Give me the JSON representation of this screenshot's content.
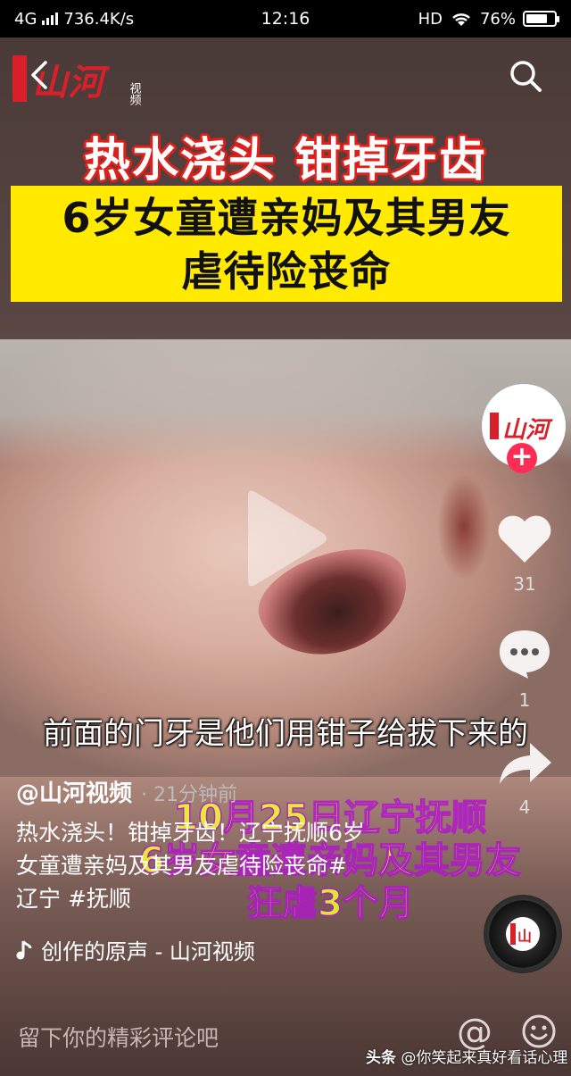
{
  "status_bar": {
    "network": "4G",
    "speed": "736.4K/s",
    "time": "12:16",
    "hd": "HD",
    "battery": "76%",
    "battery_level": 0.76
  },
  "header": {
    "logo_text": "山河",
    "logo_sub": "视频"
  },
  "video": {
    "headline": "热水浇头 钳掉牙齿",
    "subheadline_line1": "6岁女童遭亲妈及其男友",
    "subheadline_line2": "虐待险丧命",
    "caption": "前面的门牙是他们用钳子给拔下来的",
    "overlay_line1": "10月25日辽宁抚顺",
    "overlay_line2": "6岁女童遭亲妈及其男友",
    "overlay_line3": "狂虐3个月"
  },
  "sidebar": {
    "like_count": "31",
    "comment_count": "1",
    "share_count": "4"
  },
  "post": {
    "author": "@山河视频",
    "time_ago": "· 21分钟前",
    "description_line1": "热水浇头！钳掉牙齿！辽宁抚顺6岁",
    "description_line2": "女童遭亲妈及其男友虐待险丧命#",
    "description_line3": "辽宁 #抚顺",
    "sound": "创作的原声 - 山河视频"
  },
  "comment_bar": {
    "placeholder": "留下你的精彩评论吧"
  },
  "watermark": {
    "brand": "头条",
    "handle": "@你笑起来真好看话心理"
  },
  "colors": {
    "headline_outline": "#e0201c",
    "banner_yellow": "#ffea00",
    "follow_pink": "#ff2d55"
  }
}
